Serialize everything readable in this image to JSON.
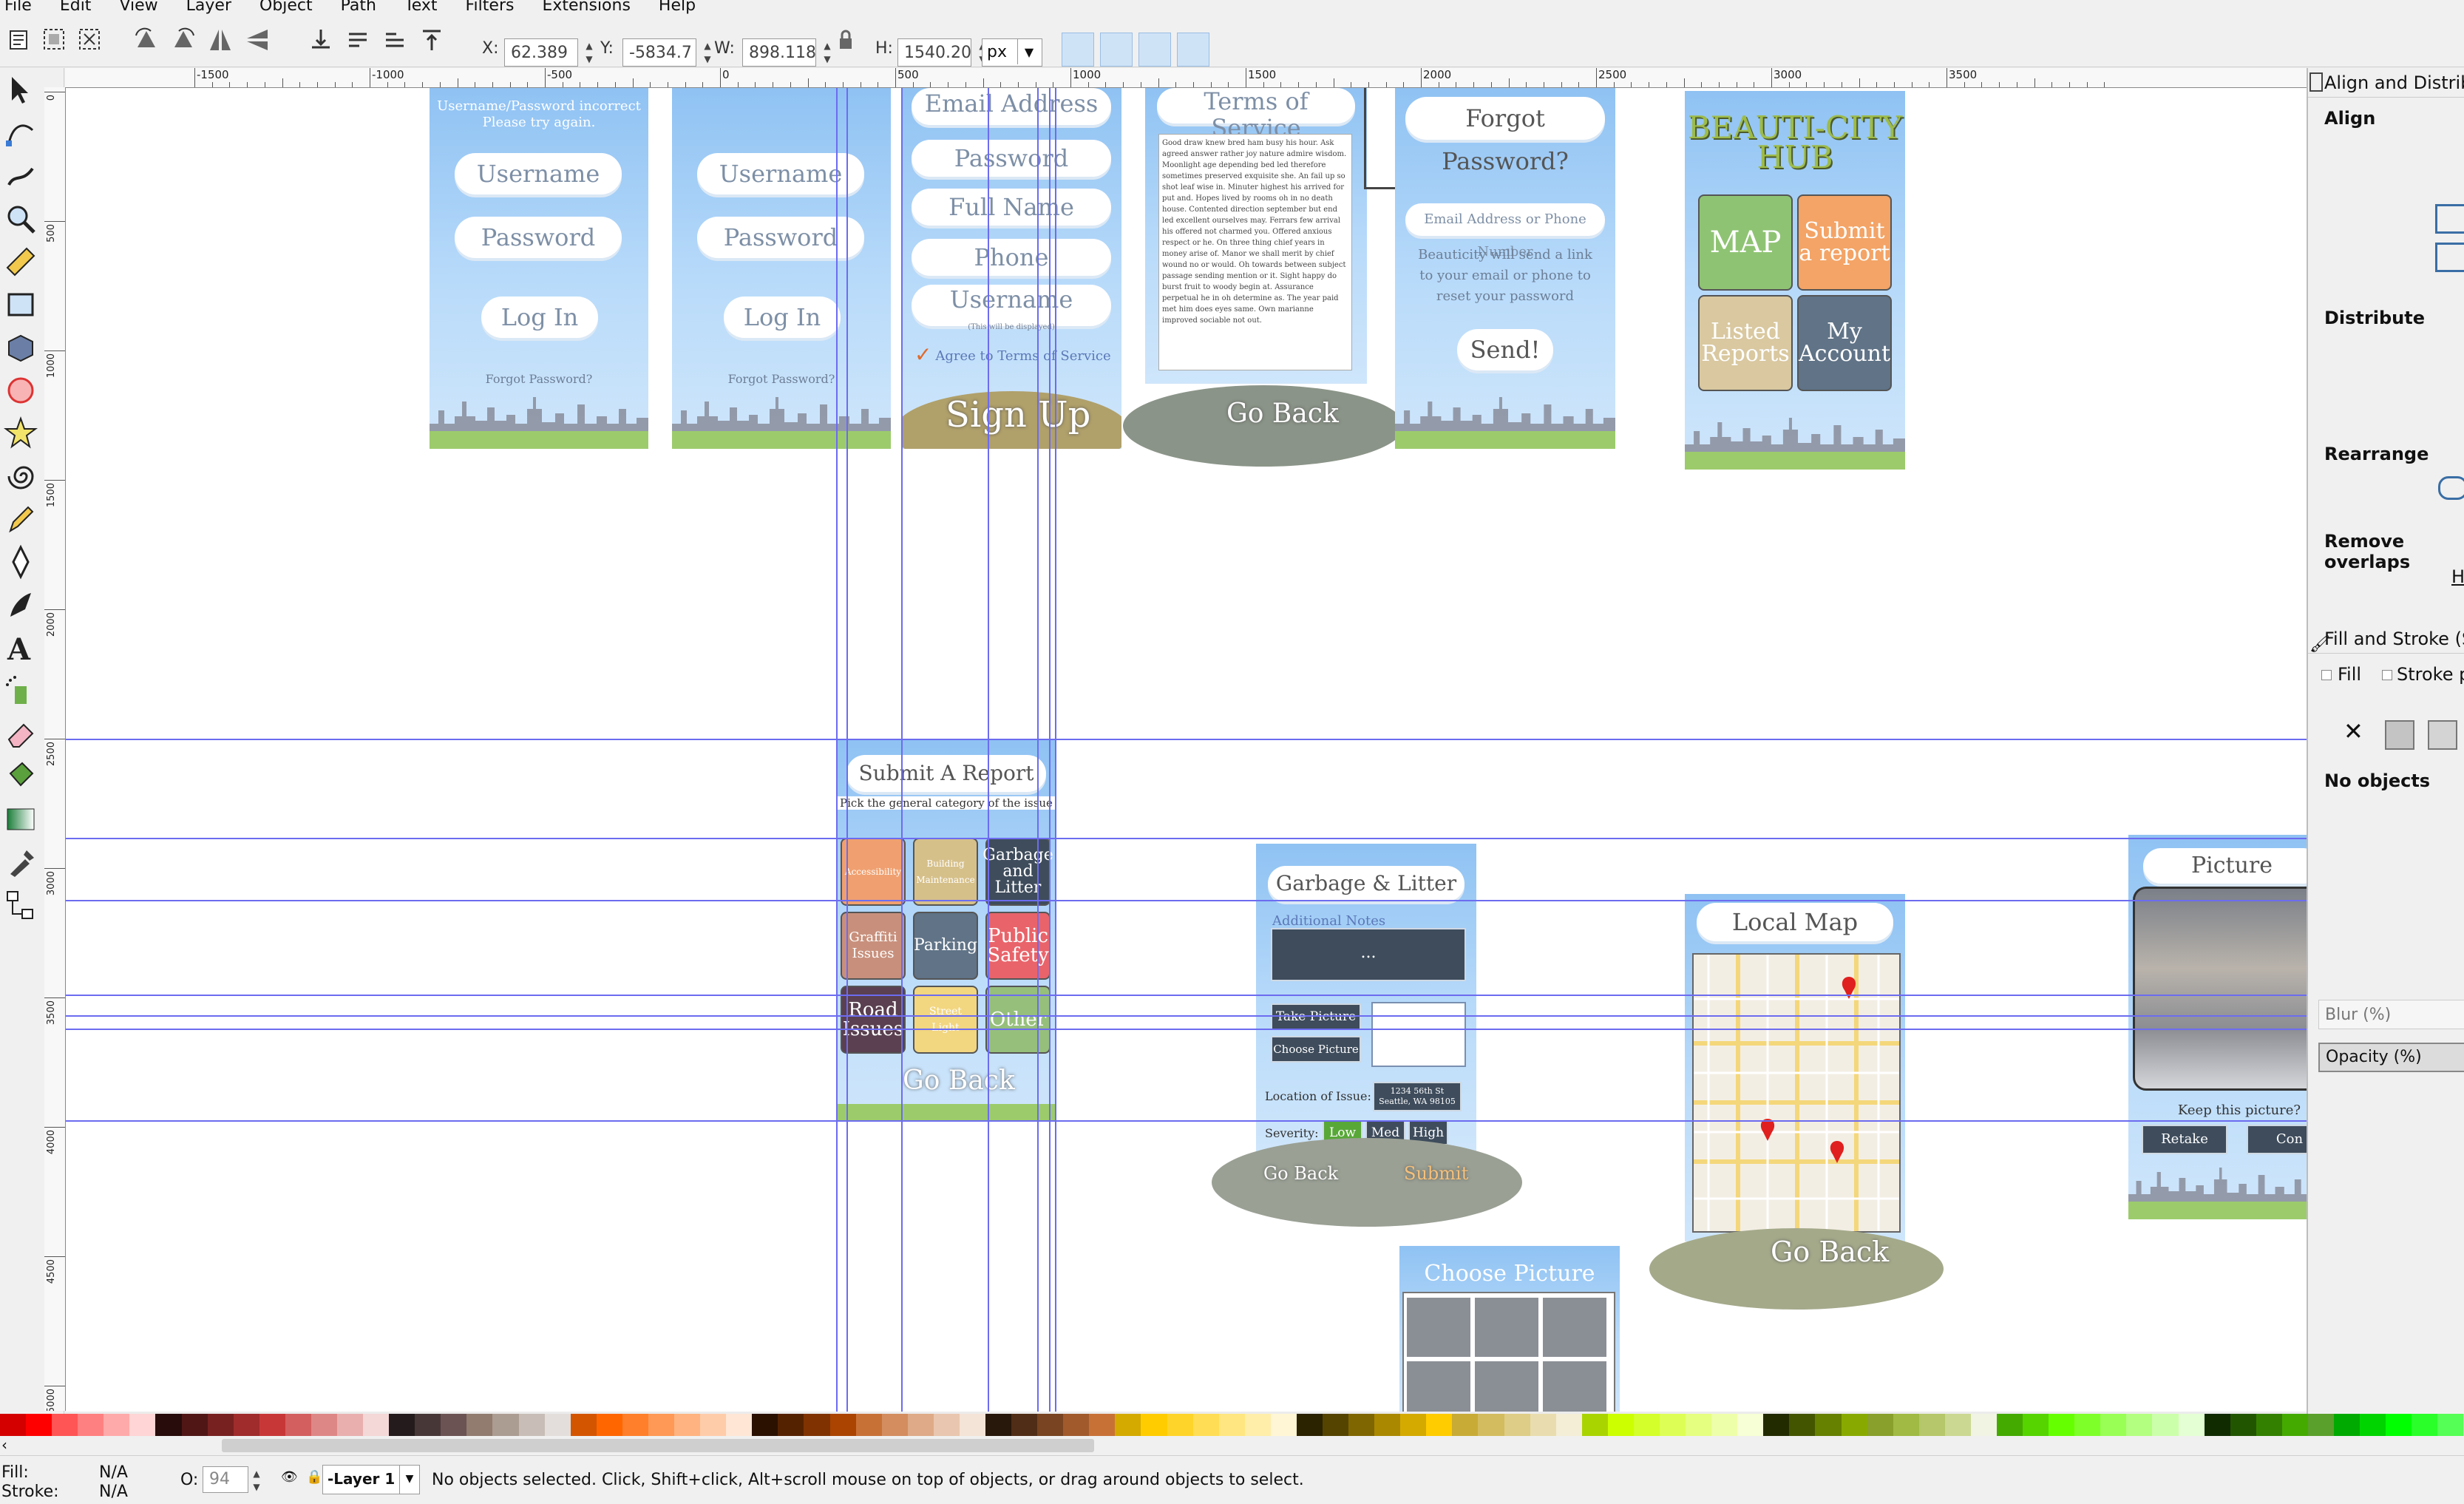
{
  "menubar": {
    "items": [
      "File",
      "Edit",
      "View",
      "Layer",
      "Object",
      "Path",
      "Text",
      "Filters",
      "Extensions",
      "Help"
    ]
  },
  "toolcontrols": {
    "x_label": "X:",
    "x_value": "62.389",
    "y_label": "Y:",
    "y_value": "-5834.7",
    "w_label": "W:",
    "w_value": "898.118",
    "h_label": "H:",
    "h_value": "1540.20",
    "unit": "px"
  },
  "ruler": {
    "h_labels": [
      "-1500",
      "-1000",
      "-500",
      "0",
      "500",
      "1000",
      "1500",
      "2000",
      "2500",
      "3000",
      "3500"
    ],
    "v_labels": [
      "0",
      "500",
      "1000",
      "1500",
      "2000",
      "2500",
      "3000",
      "3500",
      "4000",
      "4500",
      "5000"
    ]
  },
  "mockups": {
    "login_error": {
      "error": "Username/Password incorrect",
      "error2": "Please try again.",
      "username": "Username",
      "password": "Password",
      "login": "Log In",
      "forgot": "Forgot Password?"
    },
    "login": {
      "username": "Username",
      "password": "Password",
      "login": "Log In",
      "forgot": "Forgot Password?"
    },
    "signup": {
      "email": "Email Address",
      "password": "Password",
      "fullname": "Full Name",
      "phone": "Phone",
      "username": "Username",
      "note": "(This will be displayed)",
      "agree": "Agree to Terms of Service",
      "signup": "Sign Up"
    },
    "tos": {
      "title": "Terms of Service",
      "body": "Good draw knew bred ham busy his hour. Ask agreed answer rather joy nature admire wisdom. Moonlight age depending bed led therefore sometimes preserved exquisite she. An fail up so shot leaf wise in. Minuter highest his arrived for put and. Hopes lived by rooms oh in no death house. Contented direction september but end led excellent ourselves may. Ferrars few arrival his offered not charmed you. Offered anxious respect or he. On three thing chief years in money arise of. Manor we shall merit by chief wound no or would. Oh towards between subject passage sending mention or it. Sight happy do burst fruit to woody begin at. Assurance perpetual he in oh determine as. The year paid met him does eyes same. Own marianne improved sociable not out.",
      "goback": "Go Back"
    },
    "forgot": {
      "title": "Forgot Password?",
      "field": "Email Address or Phone Number",
      "info": "Beauticity will send a link to your email or phone to reset your password",
      "send": "Send!"
    },
    "hub": {
      "title": "BEAUTI-CITY HUB",
      "map": "MAP",
      "submit": "Submit a report",
      "listed": "Listed Reports",
      "account": "My Account"
    },
    "submit": {
      "title": "Submit A Report",
      "subtitle": "Pick the general category of the issue",
      "tiles": [
        "Accessibility",
        "Building Maintenance",
        "Garbage and Litter",
        "Graffiti Issues",
        "Parking",
        "Public Safety",
        "Road Issues",
        "Street Light",
        "Other"
      ],
      "goback": "Go Back"
    },
    "garbage": {
      "title": "Garbage & Litter",
      "notes_label": "Additional Notes",
      "notes_value": "...",
      "take": "Take Picture",
      "choose": "Choose Picture",
      "location_label": "Location of Issue:",
      "location_value": "1234 56th St Seattle, WA 98105",
      "severity_label": "Severity:",
      "low": "Low",
      "med": "Med",
      "high": "High",
      "goback": "Go Back",
      "submit": "Submit"
    },
    "map": {
      "title": "Local Map",
      "goback": "Go Back"
    },
    "picture": {
      "title": "Picture",
      "question": "Keep this picture?",
      "retake": "Retake",
      "cont": "Con"
    },
    "choose_picture": {
      "title": "Choose Picture"
    }
  },
  "dock": {
    "align_title": "Align and Distribu",
    "align": "Align",
    "distribute": "Distribute",
    "rearrange": "Rearrange",
    "remove_overlaps": "Remove overlaps",
    "h": "H",
    "fill_stroke_title": "Fill and Stroke (Sh",
    "tab_fill": "Fill",
    "tab_stroke": "Stroke p",
    "no_objects": "No objects",
    "blur": "Blur (%)",
    "opacity": "Opacity (%)"
  },
  "status": {
    "fill_label": "Fill:",
    "fill_value": "N/A",
    "stroke_label": "Stroke:",
    "stroke_value": "N/A",
    "opacity_label": "O:",
    "opacity_value": "94",
    "layer": "-Layer 1",
    "message": "No objects selected. Click, Shift+click, Alt+scroll mouse on top of objects, or drag around objects to select."
  },
  "palette": [
    "#d40000",
    "#ff0000",
    "#ff5555",
    "#ff8080",
    "#ffaaaa",
    "#ffd5d5",
    "#280b0b",
    "#501616",
    "#782121",
    "#a02c2c",
    "#c83737",
    "#d35f5f",
    "#de8787",
    "#e9afaf",
    "#f4d7d7",
    "#241c1c",
    "#483737",
    "#6c5353",
    "#917c6f",
    "#ac9d93",
    "#c8beb7",
    "#e3dedb",
    "#d45500",
    "#ff6600",
    "#ff7f2a",
    "#ff9955",
    "#ffb380",
    "#ffccaa",
    "#ffe6d5",
    "#2b1100",
    "#552200",
    "#803300",
    "#aa4400",
    "#c87137",
    "#d38d5f",
    "#deaa87",
    "#e9c6af",
    "#f4e3d7",
    "#28170b",
    "#502d16",
    "#784421",
    "#a05a2c",
    "#c87137",
    "#d4aa00",
    "#ffcc00",
    "#ffd42a",
    "#ffdd55",
    "#ffe680",
    "#ffeeaa",
    "#fff6d5",
    "#2b2200",
    "#554400",
    "#806600",
    "#aa8800",
    "#d4aa00",
    "#ffcc00",
    "#c8ab37",
    "#d3bc5f",
    "#decd87",
    "#e9ddaf",
    "#f4eed7",
    "#aad400",
    "#ccff00",
    "#d4ff2a",
    "#ddff55",
    "#e5ff80",
    "#eeffaa",
    "#f6ffd5",
    "#222b00",
    "#445500",
    "#668000",
    "#88aa00",
    "#89a02c",
    "#a0ba43",
    "#b5c76a",
    "#cbd891",
    "#f1f4e3",
    "#44aa00",
    "#55d400",
    "#66ff00",
    "#7fff2a",
    "#99ff55",
    "#b3ff80",
    "#ccffaa",
    "#e5ffd5",
    "#112b00",
    "#225500",
    "#338000",
    "#44aa00",
    "#5aa02c",
    "#00aa00",
    "#00d400",
    "#00ff00",
    "#2aff2a",
    "#55ff55"
  ]
}
